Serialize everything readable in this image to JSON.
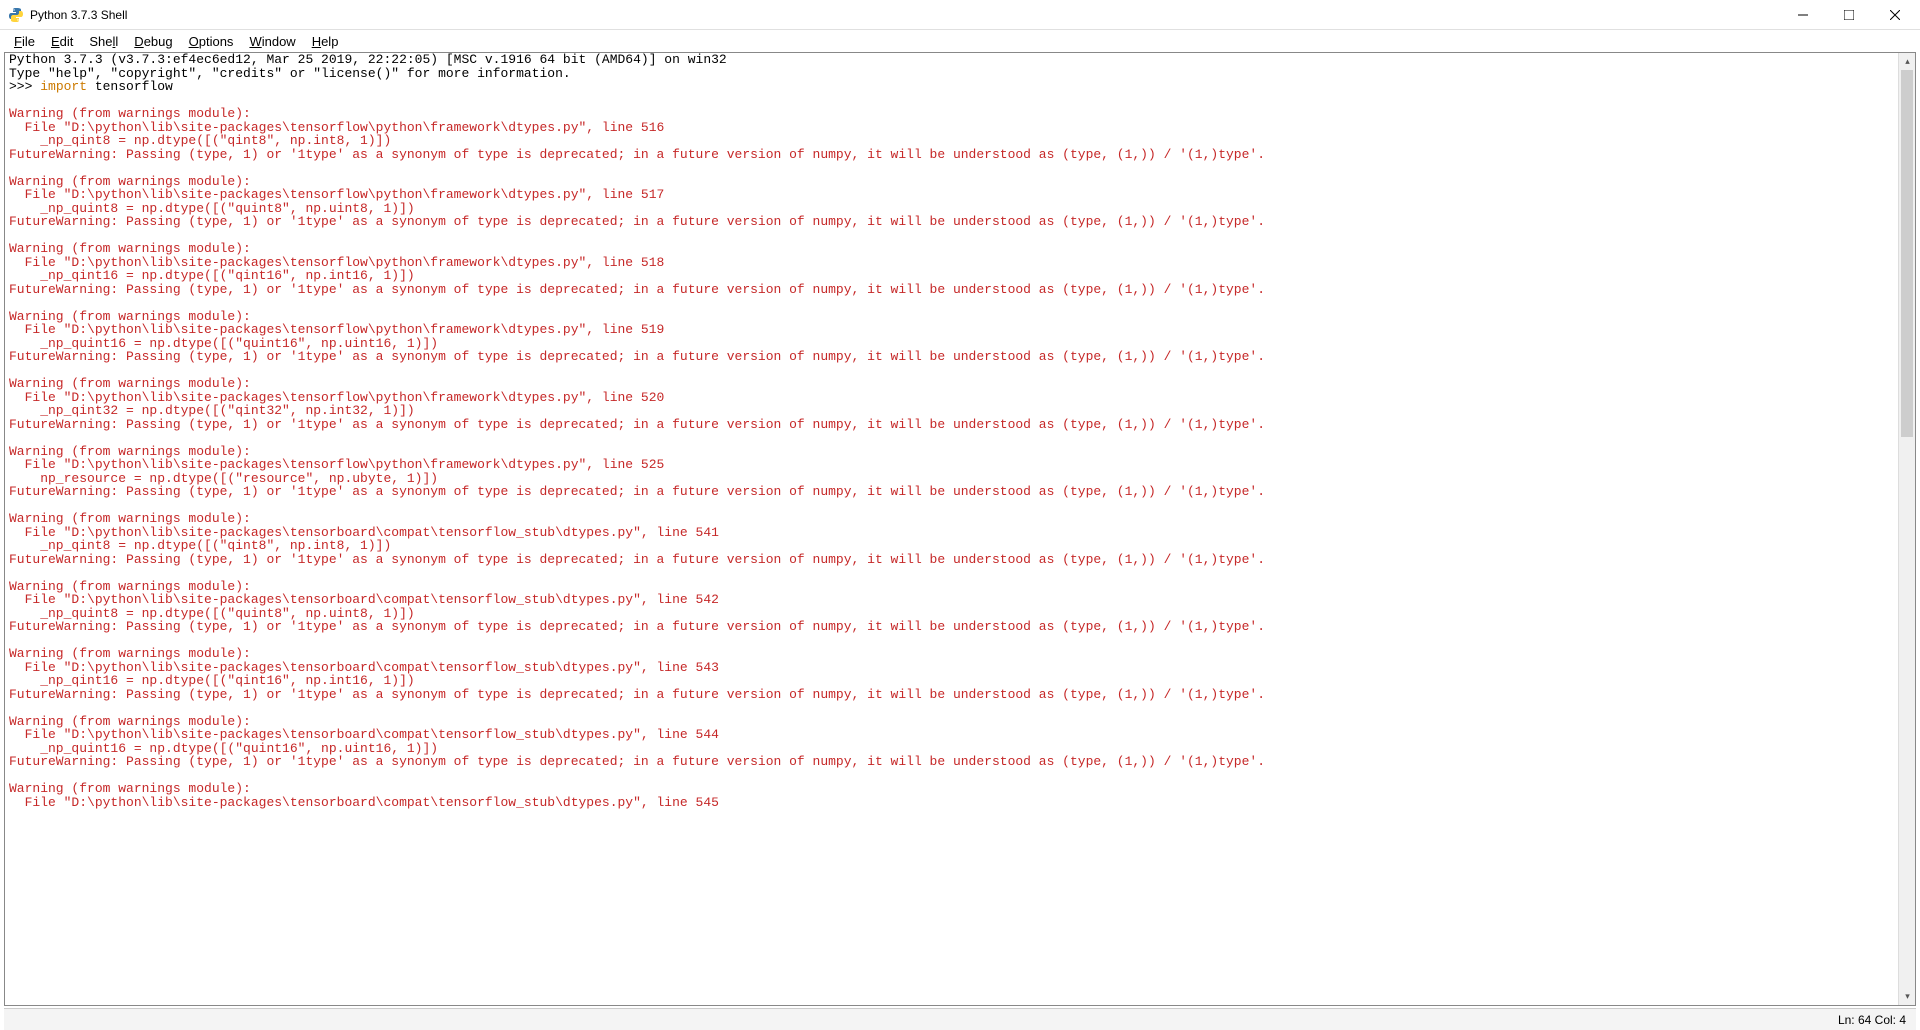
{
  "window": {
    "title": "Python 3.7.3 Shell"
  },
  "menu": {
    "file": "File",
    "edit": "Edit",
    "shell": "Shell",
    "debug": "Debug",
    "options": "Options",
    "window": "Window",
    "help": "Help"
  },
  "content": {
    "header1": "Python 3.7.3 (v3.7.3:ef4ec6ed12, Mar 25 2019, 22:22:05) [MSC v.1916 64 bit (AMD64)] on win32",
    "header2": "Type \"help\", \"copyright\", \"credits\" or \"license()\" for more information.",
    "prompt": ">>> ",
    "kw_import": "import",
    "mod": " tensorflow",
    "blank": "",
    "warnings": [
      {
        "l1": "Warning (from warnings module):",
        "l2": "  File \"D:\\python\\lib\\site-packages\\tensorflow\\python\\framework\\dtypes.py\", line 516",
        "l3": "    _np_qint8 = np.dtype([(\"qint8\", np.int8, 1)])",
        "l4": "FutureWarning: Passing (type, 1) or '1type' as a synonym of type is deprecated; in a future version of numpy, it will be understood as (type, (1,)) / '(1,)type'."
      },
      {
        "l1": "Warning (from warnings module):",
        "l2": "  File \"D:\\python\\lib\\site-packages\\tensorflow\\python\\framework\\dtypes.py\", line 517",
        "l3": "    _np_quint8 = np.dtype([(\"quint8\", np.uint8, 1)])",
        "l4": "FutureWarning: Passing (type, 1) or '1type' as a synonym of type is deprecated; in a future version of numpy, it will be understood as (type, (1,)) / '(1,)type'."
      },
      {
        "l1": "Warning (from warnings module):",
        "l2": "  File \"D:\\python\\lib\\site-packages\\tensorflow\\python\\framework\\dtypes.py\", line 518",
        "l3": "    _np_qint16 = np.dtype([(\"qint16\", np.int16, 1)])",
        "l4": "FutureWarning: Passing (type, 1) or '1type' as a synonym of type is deprecated; in a future version of numpy, it will be understood as (type, (1,)) / '(1,)type'."
      },
      {
        "l1": "Warning (from warnings module):",
        "l2": "  File \"D:\\python\\lib\\site-packages\\tensorflow\\python\\framework\\dtypes.py\", line 519",
        "l3": "    _np_quint16 = np.dtype([(\"quint16\", np.uint16, 1)])",
        "l4": "FutureWarning: Passing (type, 1) or '1type' as a synonym of type is deprecated; in a future version of numpy, it will be understood as (type, (1,)) / '(1,)type'."
      },
      {
        "l1": "Warning (from warnings module):",
        "l2": "  File \"D:\\python\\lib\\site-packages\\tensorflow\\python\\framework\\dtypes.py\", line 520",
        "l3": "    _np_qint32 = np.dtype([(\"qint32\", np.int32, 1)])",
        "l4": "FutureWarning: Passing (type, 1) or '1type' as a synonym of type is deprecated; in a future version of numpy, it will be understood as (type, (1,)) / '(1,)type'."
      },
      {
        "l1": "Warning (from warnings module):",
        "l2": "  File \"D:\\python\\lib\\site-packages\\tensorflow\\python\\framework\\dtypes.py\", line 525",
        "l3": "    np_resource = np.dtype([(\"resource\", np.ubyte, 1)])",
        "l4": "FutureWarning: Passing (type, 1) or '1type' as a synonym of type is deprecated; in a future version of numpy, it will be understood as (type, (1,)) / '(1,)type'."
      },
      {
        "l1": "Warning (from warnings module):",
        "l2": "  File \"D:\\python\\lib\\site-packages\\tensorboard\\compat\\tensorflow_stub\\dtypes.py\", line 541",
        "l3": "    _np_qint8 = np.dtype([(\"qint8\", np.int8, 1)])",
        "l4": "FutureWarning: Passing (type, 1) or '1type' as a synonym of type is deprecated; in a future version of numpy, it will be understood as (type, (1,)) / '(1,)type'."
      },
      {
        "l1": "Warning (from warnings module):",
        "l2": "  File \"D:\\python\\lib\\site-packages\\tensorboard\\compat\\tensorflow_stub\\dtypes.py\", line 542",
        "l3": "    _np_quint8 = np.dtype([(\"quint8\", np.uint8, 1)])",
        "l4": "FutureWarning: Passing (type, 1) or '1type' as a synonym of type is deprecated; in a future version of numpy, it will be understood as (type, (1,)) / '(1,)type'."
      },
      {
        "l1": "Warning (from warnings module):",
        "l2": "  File \"D:\\python\\lib\\site-packages\\tensorboard\\compat\\tensorflow_stub\\dtypes.py\", line 543",
        "l3": "    _np_qint16 = np.dtype([(\"qint16\", np.int16, 1)])",
        "l4": "FutureWarning: Passing (type, 1) or '1type' as a synonym of type is deprecated; in a future version of numpy, it will be understood as (type, (1,)) / '(1,)type'."
      },
      {
        "l1": "Warning (from warnings module):",
        "l2": "  File \"D:\\python\\lib\\site-packages\\tensorboard\\compat\\tensorflow_stub\\dtypes.py\", line 544",
        "l3": "    _np_quint16 = np.dtype([(\"quint16\", np.uint16, 1)])",
        "l4": "FutureWarning: Passing (type, 1) or '1type' as a synonym of type is deprecated; in a future version of numpy, it will be understood as (type, (1,)) / '(1,)type'."
      }
    ],
    "partial": {
      "l1": "Warning (from warnings module):",
      "l2": "  File \"D:\\python\\lib\\site-packages\\tensorboard\\compat\\tensorflow_stub\\dtypes.py\", line 545"
    }
  },
  "status": {
    "text": "Ln: 64  Col: 4"
  }
}
